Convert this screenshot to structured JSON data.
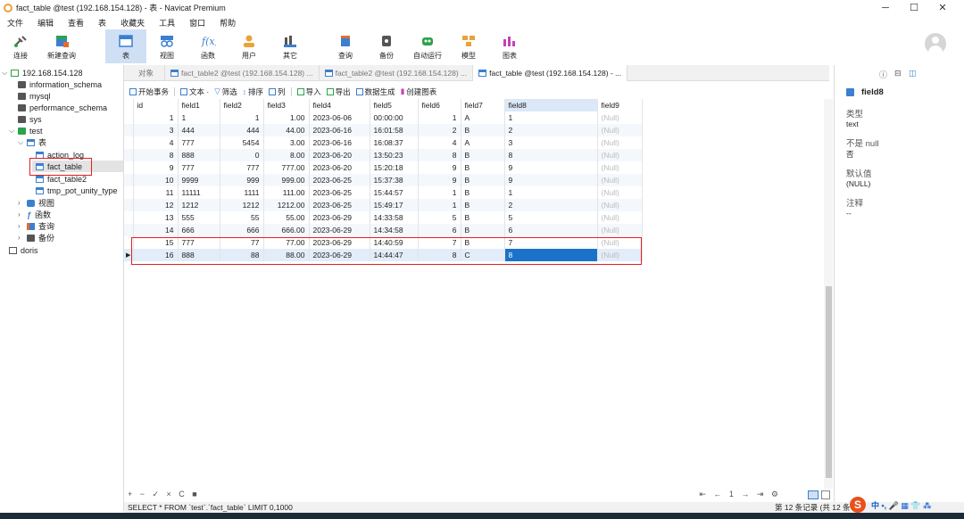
{
  "window": {
    "title": "fact_table @test (192.168.154.128) - 表 - Navicat Premium",
    "minimize": "─",
    "maximize": "☐",
    "close": "✕"
  },
  "menu": [
    "文件",
    "编辑",
    "查看",
    "表",
    "收藏夹",
    "工具",
    "窗口",
    "帮助"
  ],
  "toolbar": {
    "connect": "连接",
    "new_query": "新建查询",
    "table": "表",
    "view": "视图",
    "function": "函数",
    "user": "用户",
    "other": "其它",
    "query": "查询",
    "backup": "备份",
    "automation": "自动运行",
    "model": "模型",
    "chart": "图表"
  },
  "sidebar": {
    "connection": "192.168.154.128",
    "databases": [
      "information_schema",
      "mysql",
      "performance_schema",
      "sys"
    ],
    "test_db": "test",
    "tables_group": "表",
    "tables": [
      "action_log",
      "fact_table",
      "fact_table2",
      "tmp_pot_unity_type"
    ],
    "views": "视图",
    "functions": "函数",
    "queries": "查询",
    "backups": "备份",
    "doris": "doris"
  },
  "tabs": {
    "object": "对象",
    "tab1": "fact_table2 @test (192.168.154.128) ...",
    "tab2": "fact_table2 @test (192.168.154.128) ...",
    "tab3": "fact_table @test (192.168.154.128) - ..."
  },
  "subbar": {
    "begin_tx": "开始事务",
    "text": "文本 ·",
    "filter": "筛选",
    "sort": "排序",
    "columns": "列",
    "import": "导入",
    "export": "导出",
    "data_gen": "数据生成",
    "create_chart": "创建图表"
  },
  "grid": {
    "columns": [
      "id",
      "field1",
      "field2",
      "field3",
      "field4",
      "field5",
      "field6",
      "field7",
      "field8",
      "field9"
    ],
    "rows": [
      [
        "1",
        "1",
        "1",
        "1.00",
        "2023-06-06",
        "00:00:00",
        "1",
        "A",
        "1",
        "(Null)"
      ],
      [
        "3",
        "444",
        "444",
        "44.00",
        "2023-06-16",
        "16:01:58",
        "2",
        "B",
        "2",
        "(Null)"
      ],
      [
        "4",
        "777",
        "5454",
        "3.00",
        "2023-06-16",
        "16:08:37",
        "4",
        "A",
        "3",
        "(Null)"
      ],
      [
        "8",
        "888",
        "0",
        "8.00",
        "2023-06-20",
        "13:50:23",
        "8",
        "B",
        "8",
        "(Null)"
      ],
      [
        "9",
        "777",
        "777",
        "777.00",
        "2023-06-20",
        "15:20:18",
        "9",
        "B",
        "9",
        "(Null)"
      ],
      [
        "10",
        "9999",
        "999",
        "999.00",
        "2023-06-25",
        "15:37:38",
        "9",
        "B",
        "9",
        "(Null)"
      ],
      [
        "11",
        "11111",
        "1111",
        "111.00",
        "2023-06-25",
        "15:44:57",
        "1",
        "B",
        "1",
        "(Null)"
      ],
      [
        "12",
        "1212",
        "1212",
        "1212.00",
        "2023-06-25",
        "15:49:17",
        "1",
        "B",
        "2",
        "(Null)"
      ],
      [
        "13",
        "555",
        "55",
        "55.00",
        "2023-06-29",
        "14:33:58",
        "5",
        "B",
        "5",
        "(Null)"
      ],
      [
        "14",
        "666",
        "666",
        "666.00",
        "2023-06-29",
        "14:34:58",
        "6",
        "B",
        "6",
        "(Null)"
      ],
      [
        "15",
        "777",
        "77",
        "77.00",
        "2023-06-29",
        "14:40:59",
        "7",
        "B",
        "7",
        "(Null)"
      ],
      [
        "16",
        "888",
        "88",
        "88.00",
        "2023-06-29",
        "14:44:47",
        "8",
        "C",
        "8",
        "(Null)"
      ]
    ]
  },
  "bottom": {
    "controls": "+ − ✓ × C ■",
    "nav": "⇤ ← 1 → ⇥ ⚙",
    "sql": "SELECT * FROM `test`.`fact_table` LIMIT 0,1000",
    "record": "第 12 条记录 (共 12 条"
  },
  "right_panel": {
    "field_name": "field8",
    "type_label": "类型",
    "type_value": "text",
    "not_null_label": "不是 null",
    "not_null_value": "否",
    "default_label": "默认值",
    "default_value": "(NULL)",
    "comment_label": "注释",
    "comment_value": "--"
  },
  "ime": {
    "logo": "S",
    "text": "中 •, 🎤 ▦ 👕 ⁂"
  }
}
